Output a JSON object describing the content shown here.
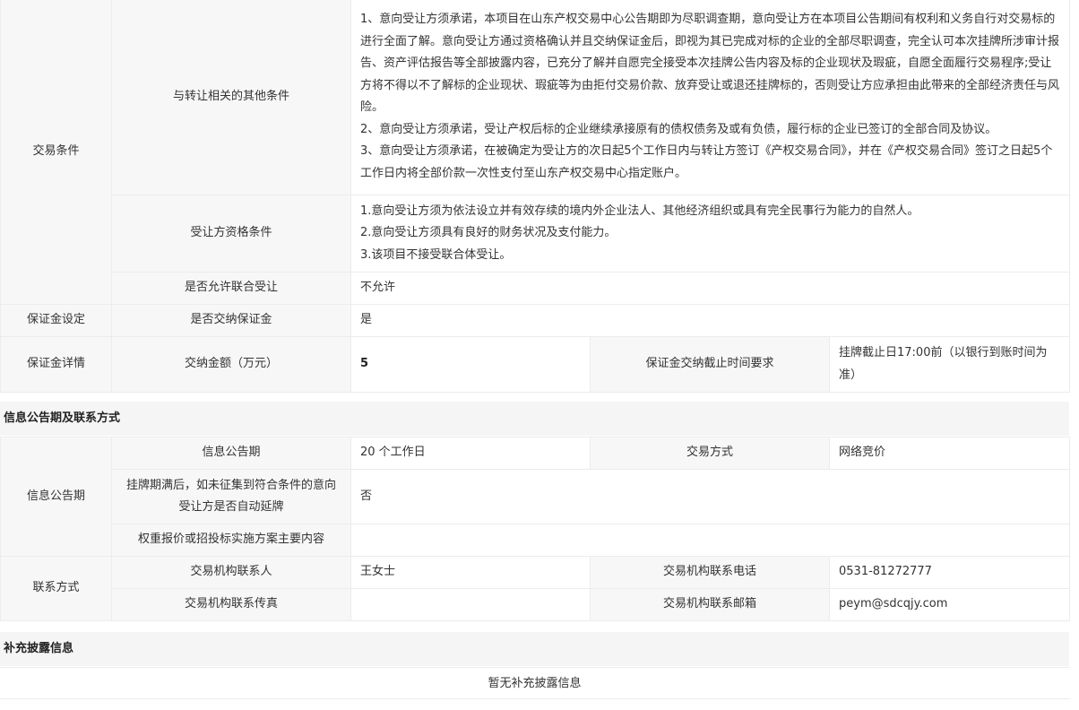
{
  "trade": {
    "label": "交易条件",
    "other_conditions_label": "与转让相关的其他条件",
    "other_conditions": [
      "1、意向受让方须承诺，本项目在山东产权交易中心公告期即为尽职调查期，意向受让方在本项目公告期间有权利和义务自行对交易标的进行全面了解。意向受让方通过资格确认并且交纳保证金后，即视为其已完成对标的企业的全部尽职调查，完全认可本次挂牌所涉审计报告、资产评估报告等全部披露内容，已充分了解并自愿完全接受本次挂牌公告内容及标的企业现状及瑕疵，自愿全面履行交易程序;受让方将不得以不了解标的企业现状、瑕疵等为由拒付交易价款、放弃受让或退还挂牌标的，否则受让方应承担由此带来的全部经济责任与风险。",
      "2、意向受让方须承诺，受让产权后标的企业继续承接原有的债权债务及或有负债，履行标的企业已签订的全部合同及协议。",
      "3、意向受让方须承诺，在被确定为受让方的次日起5个工作日内与转让方签订《产权交易合同》，并在《产权交易合同》签订之日起5个工作日内将全部价款一次性支付至山东产权交易中心指定账户。"
    ],
    "qualification_label": "受让方资格条件",
    "qualification": [
      "1.意向受让方须为依法设立并有效存续的境内外企业法人、其他经济组织或具有完全民事行为能力的自然人。",
      "2.意向受让方须具有良好的财务状况及支付能力。",
      "3.该项目不接受联合体受让。"
    ],
    "joint_label": "是否允许联合受让",
    "joint_value": "不允许"
  },
  "deposit": {
    "setting_label": "保证金设定",
    "pay_label": "是否交纳保证金",
    "pay_value": "是",
    "detail_label": "保证金详情",
    "amount_label": "交纳金额（万元）",
    "amount_value": "5",
    "deadline_label": "保证金交纳截止时间要求",
    "deadline_value": "挂牌截止日17:00前（以银行到账时间为准）"
  },
  "notice": {
    "section_title": "信息公告期及联系方式",
    "group_label": "信息公告期",
    "period_label": "信息公告期",
    "period_value": "20 个工作日",
    "method_label": "交易方式",
    "method_value": "网络竞价",
    "extend_label": "挂牌期满后，如未征集到符合条件的意向受让方是否自动延牌",
    "extend_value": "否",
    "weight_label": "权重报价或招投标实施方案主要内容",
    "weight_value": ""
  },
  "contact": {
    "group_label": "联系方式",
    "person_label": "交易机构联系人",
    "person_value": "王女士",
    "phone_label": "交易机构联系电话",
    "phone_value": "0531-81272777",
    "fax_label": "交易机构联系传真",
    "fax_value": "",
    "email_label": "交易机构联系邮箱",
    "email_value": "peym@sdcqjy.com"
  },
  "supplement": {
    "section_title": "补充披露信息",
    "empty_text": "暂无补充披露信息"
  }
}
